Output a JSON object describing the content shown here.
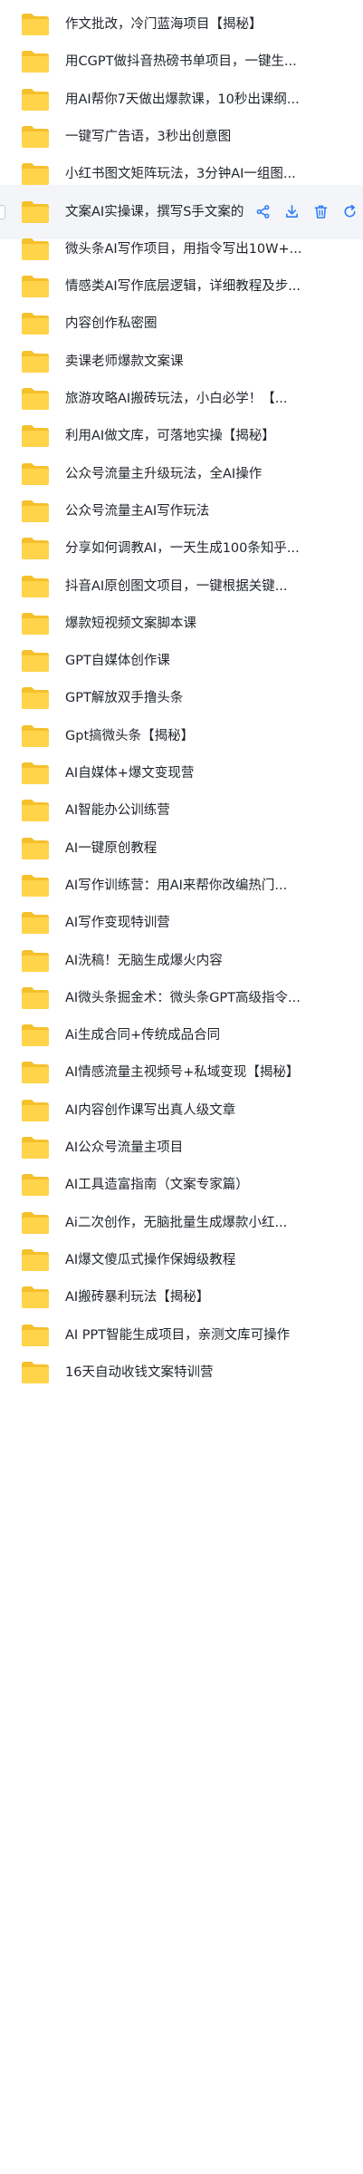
{
  "colors": {
    "folder_back": "#f5c02c",
    "folder_front": "#ffd44a",
    "action_blue": "#2f7cf6",
    "text": "#1f2329",
    "hover_bg": "#f3f5f9"
  },
  "row_actions": [
    "share-icon",
    "download-icon",
    "delete-icon",
    "more-icon"
  ],
  "hovered_index": 5,
  "items": [
    {
      "label": "作文批改，冷门蓝海项目【揭秘】"
    },
    {
      "label": "用CGPT做抖音热磅书单项目，一键生..."
    },
    {
      "label": "用AI帮你7天做出爆款课，10秒出课纲..."
    },
    {
      "label": "一键写广告语，3秒出创意图"
    },
    {
      "label": "小红书图文矩阵玩法，3分钟AI一组图..."
    },
    {
      "label": "文案AI实操课，撰写S手文案的"
    },
    {
      "label": "微头条AI写作项目，用指令写出10W+..."
    },
    {
      "label": "情感类AI写作底层逻辑，详细教程及步..."
    },
    {
      "label": "内容创作私密圈"
    },
    {
      "label": "卖课老师爆款文案课"
    },
    {
      "label": "旅游攻略AI搬砖玩法，小白必学！【..."
    },
    {
      "label": "利用AI做文库，可落地实操【揭秘】"
    },
    {
      "label": "公众号流量主升级玩法，全AI操作"
    },
    {
      "label": "公众号流量主AI写作玩法"
    },
    {
      "label": "分享如何调教AI，一天生成100条知乎..."
    },
    {
      "label": "抖音AI原创图文项目，一键根据关键..."
    },
    {
      "label": "爆款短视频文案脚本课"
    },
    {
      "label": "GPT自媒体创作课"
    },
    {
      "label": "GPT解放双手撸头条"
    },
    {
      "label": "Gpt搞微头条【揭秘】"
    },
    {
      "label": "AI自媒体+爆文变现营"
    },
    {
      "label": "AI智能办公训练营"
    },
    {
      "label": "AI一键原创教程"
    },
    {
      "label": "AI写作训练营：用AI来帮你改编热门..."
    },
    {
      "label": "AI写作变现特训营"
    },
    {
      "label": "AI洗稿！无脑生成爆火内容"
    },
    {
      "label": "AI微头条掘金术：微头条GPT高级指令..."
    },
    {
      "label": "Ai生成合同+传统成品合同"
    },
    {
      "label": "AI情感流量主视频号+私域变现【揭秘】"
    },
    {
      "label": "AI内容创作课写出真人级文章"
    },
    {
      "label": "AI公众号流量主项目"
    },
    {
      "label": "AI工具造富指南（文案专家篇）"
    },
    {
      "label": "Ai二次创作，无脑批量生成爆款小红..."
    },
    {
      "label": "AI爆文傻瓜式操作保姆级教程"
    },
    {
      "label": "AI搬砖暴利玩法【揭秘】"
    },
    {
      "label": "AI PPT智能生成项目，亲测文库可操作"
    },
    {
      "label": "16天自动收钱文案特训营"
    }
  ]
}
